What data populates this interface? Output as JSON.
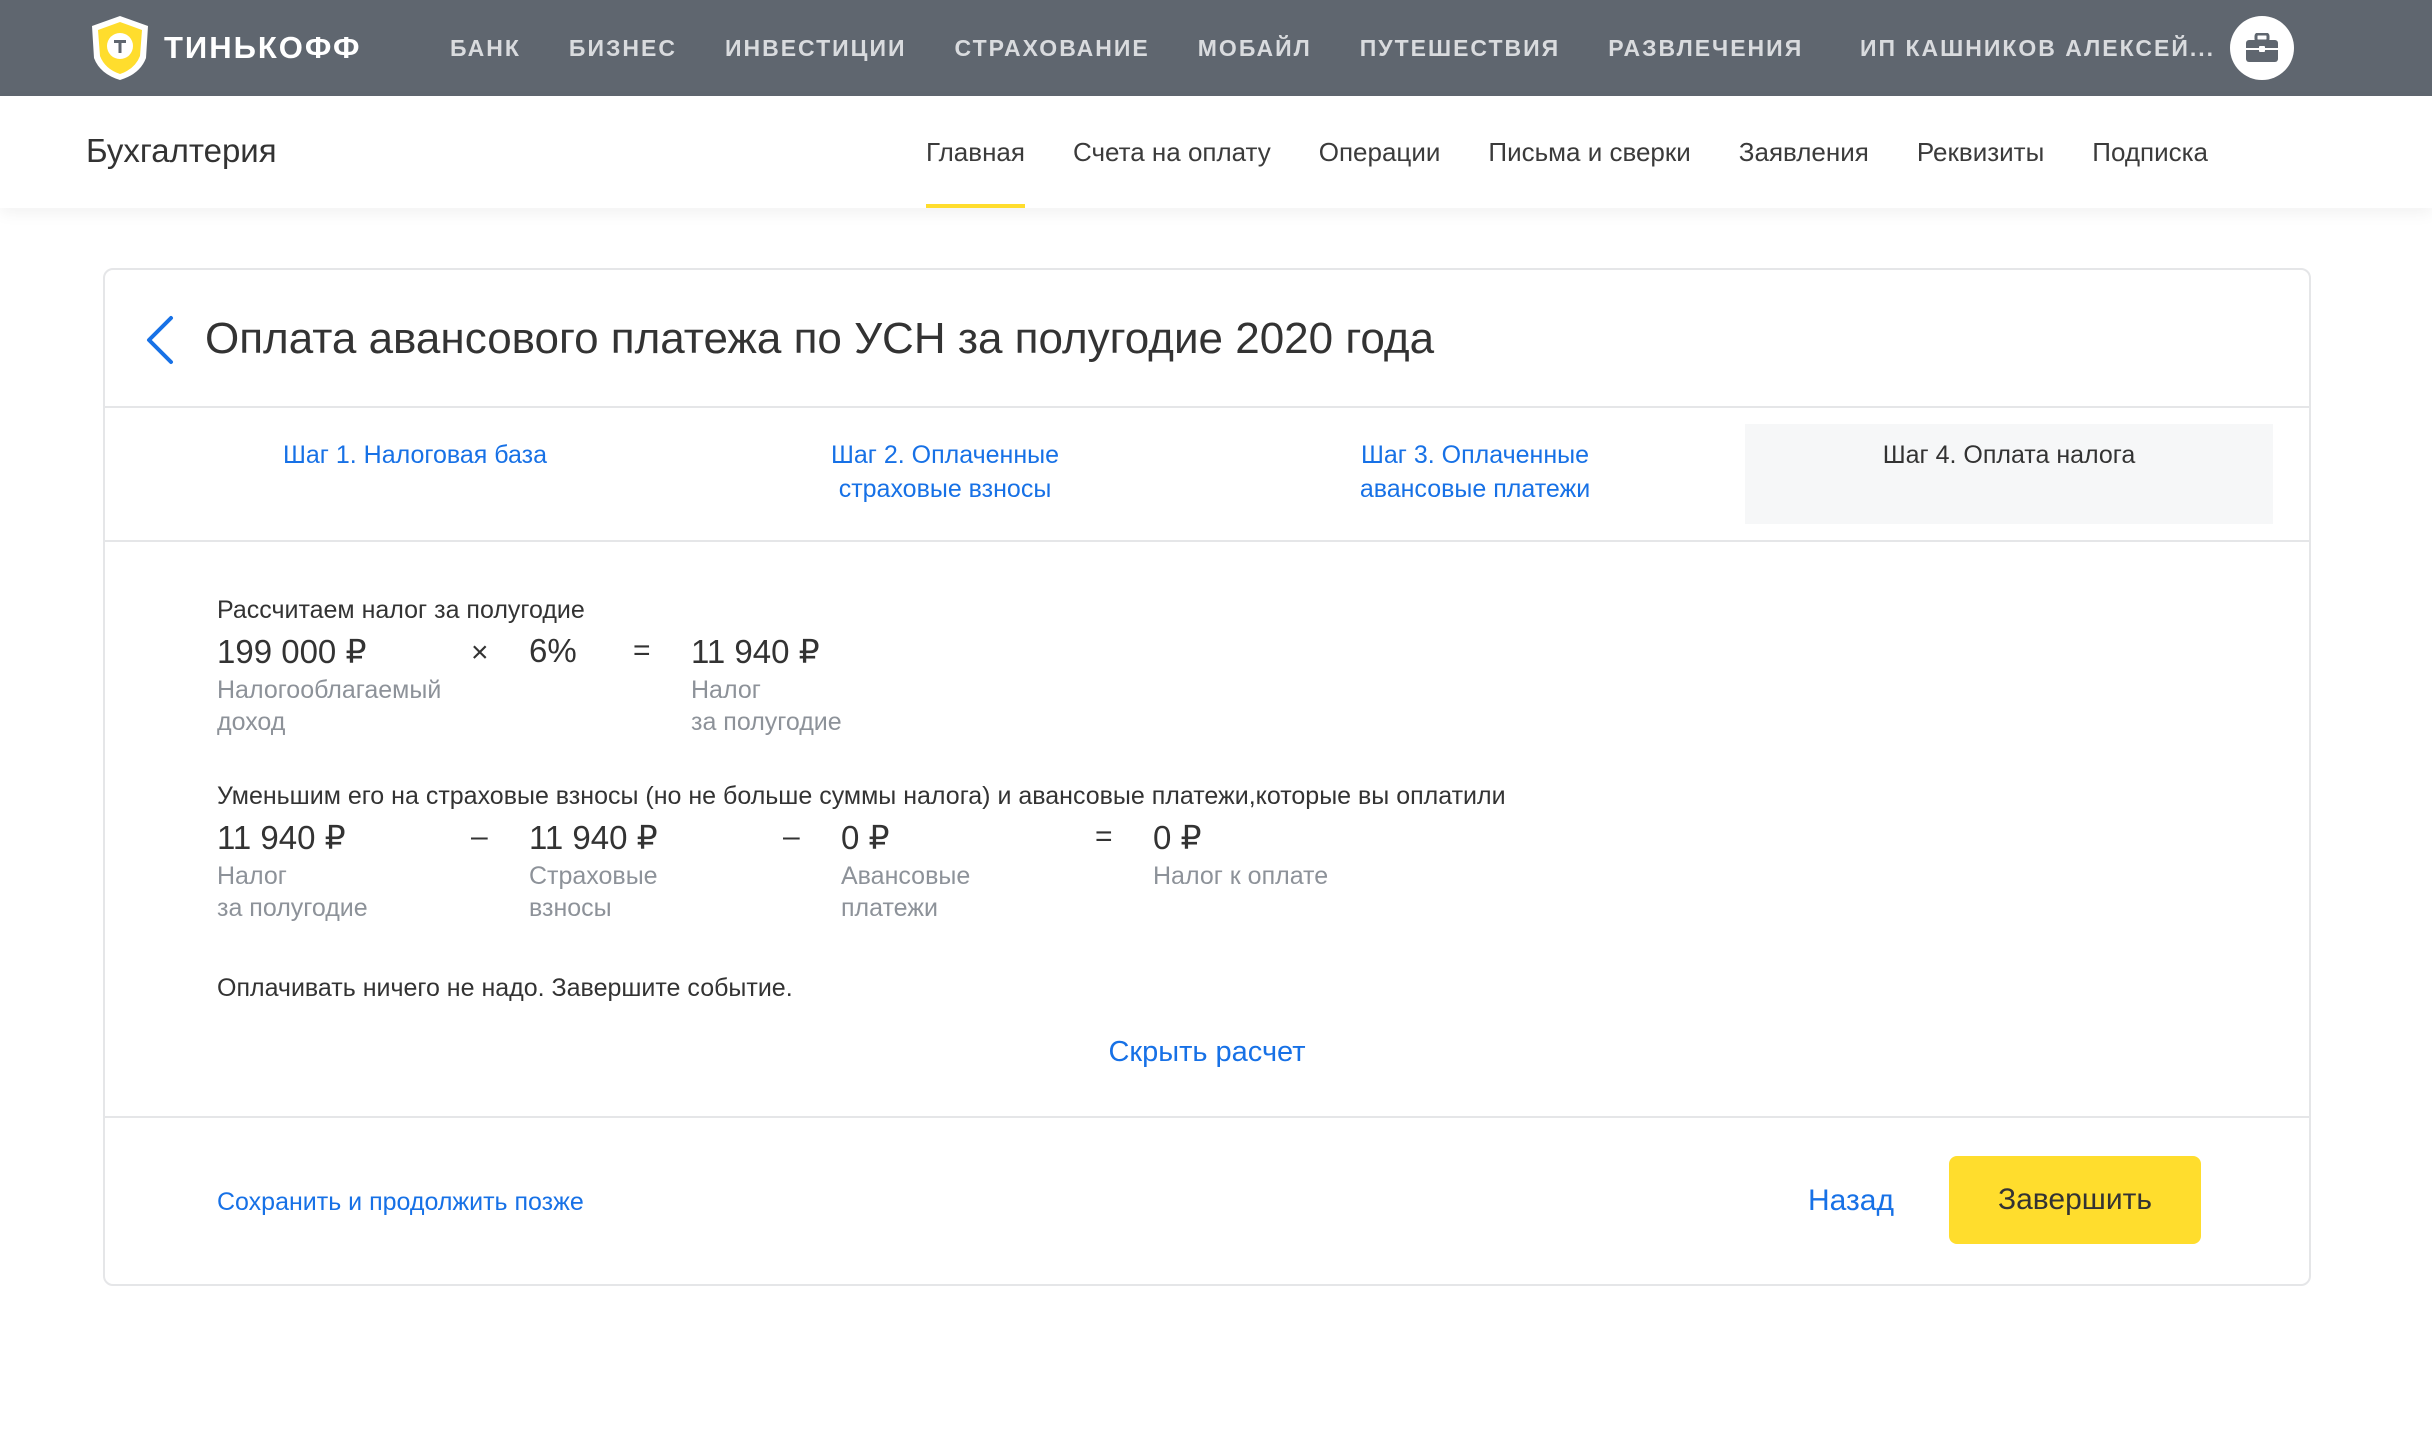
{
  "brand": {
    "name": "ТИНЬКОФФ"
  },
  "topnav": {
    "items": [
      "БАНК",
      "БИЗНЕС",
      "ИНВЕСТИЦИИ",
      "СТРАХОВАНИЕ",
      "МОБАЙЛ",
      "ПУТЕШЕСТВИЯ",
      "РАЗВЛЕЧЕНИЯ"
    ]
  },
  "user": {
    "name": "ИП КАШНИКОВ АЛЕКСЕЙ...",
    "icon": "briefcase-icon"
  },
  "subheader": {
    "title": "Бухгалтерия",
    "nav": [
      "Главная",
      "Счета на оплату",
      "Операции",
      "Письма и сверки",
      "Заявления",
      "Реквизиты",
      "Подписка"
    ],
    "active": "Главная"
  },
  "card": {
    "title": "Оплата авансового платежа по УСН за полугодие 2020 года",
    "steps": [
      {
        "label": "Шаг 1. Налоговая база"
      },
      {
        "label": "Шаг 2. Оплаченные страховые взносы"
      },
      {
        "label": "Шаг 3. Оплаченные авансовые платежи"
      },
      {
        "label": "Шаг 4. Оплата налога"
      }
    ],
    "current_step": "Шаг 4. Оплата налога",
    "calc1": {
      "heading": "Рассчитаем налог за полугодие",
      "income": "199 000 ₽",
      "income_caption": "Налогооблагаемый\nдоход",
      "op_mult": "×",
      "rate": "6%",
      "op_eq": "=",
      "tax": "11 940 ₽",
      "tax_caption": "Налог\nза полугодие"
    },
    "calc2": {
      "heading": "Уменьшим его на страховые взносы (но не больше суммы налога) и авансовые платежи,которые вы оплатили",
      "tax": "11 940 ₽",
      "tax_caption": "Налог\nза полугодие",
      "op_minus": "–",
      "insurance": "11 940 ₽",
      "insurance_caption": "Страховые\nвзносы",
      "advances": "0 ₽",
      "advances_caption": "Авансовые\nплатежи",
      "op_eq": "=",
      "to_pay": "0 ₽",
      "to_pay_caption": "Налог к оплате"
    },
    "note": "Оплачивать ничего не надо. Завершите событие.",
    "hide_link": "Скрыть расчет",
    "footer": {
      "save_later": "Сохранить и продолжить позже",
      "back": "Назад",
      "finish": "Завершить"
    }
  },
  "colors": {
    "topbar": "#5f666f",
    "accent_yellow": "#ffdd2d",
    "link_blue": "#1771e6"
  }
}
